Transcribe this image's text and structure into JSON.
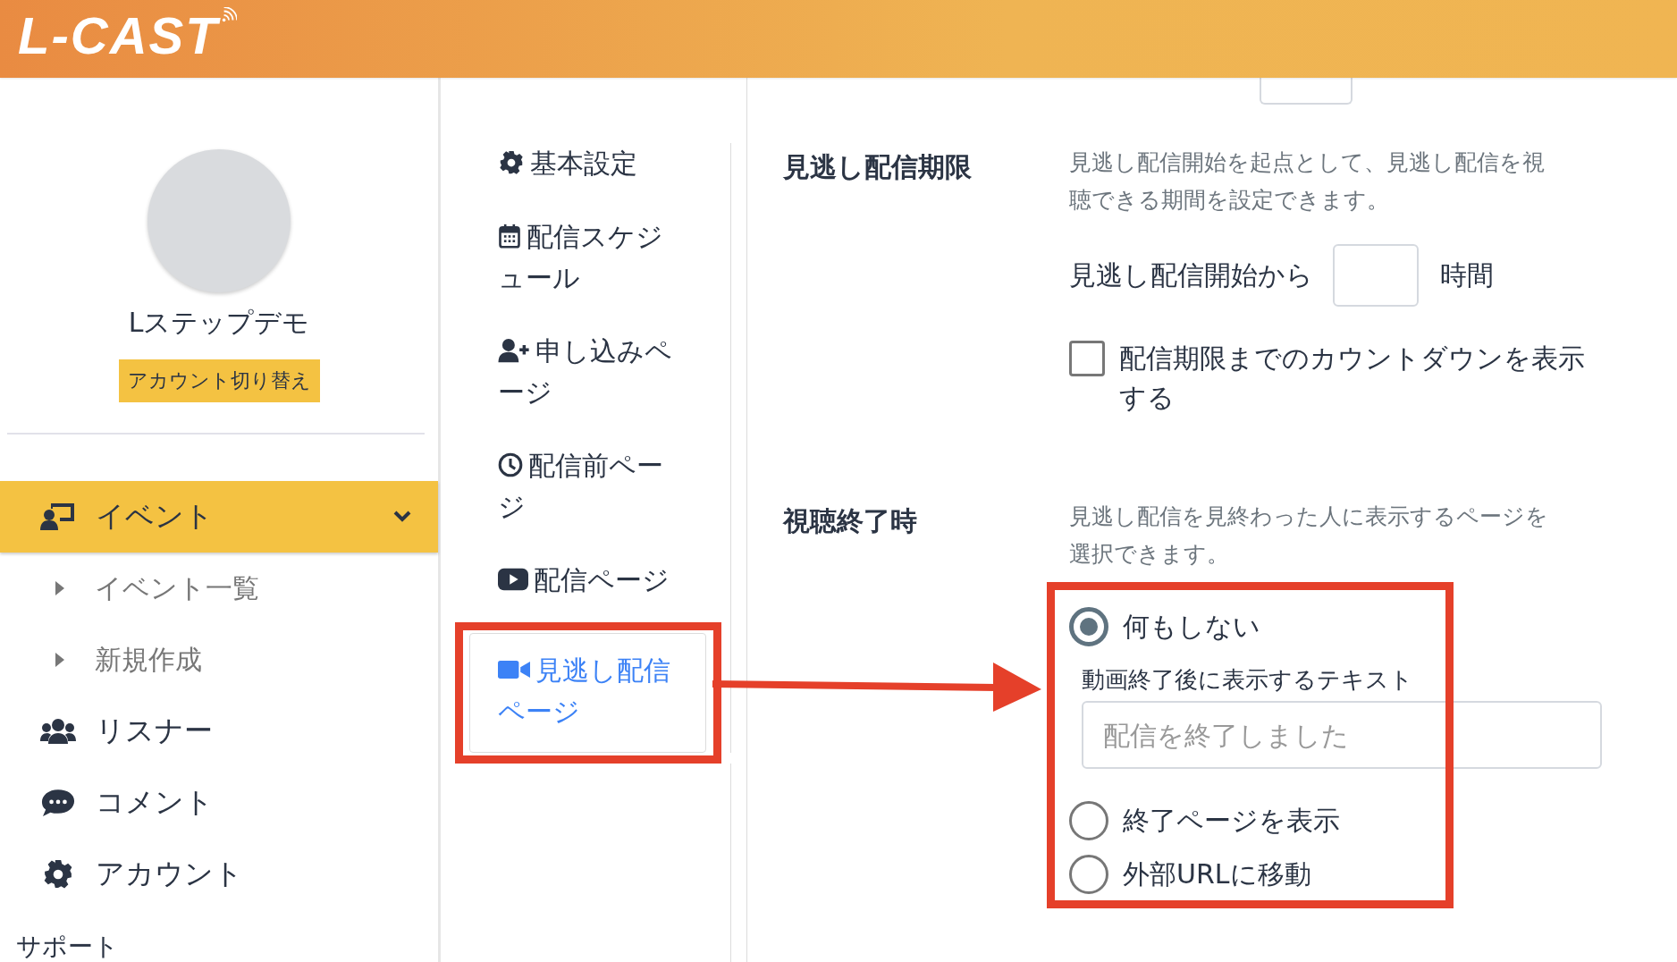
{
  "header": {
    "logo": "L-CAST"
  },
  "sidebar": {
    "user_name": "Lステップデモ",
    "switch_button": "アカウント切り替え",
    "menu": [
      {
        "label": "イベント",
        "selected": true,
        "expanded": true,
        "children": [
          {
            "label": "イベント一覧"
          },
          {
            "label": "新規作成"
          }
        ]
      },
      {
        "label": "リスナー",
        "selected": false
      },
      {
        "label": "コメント",
        "selected": false
      },
      {
        "label": "アカウント",
        "selected": false
      }
    ],
    "support": "サポート"
  },
  "settings_nav": [
    {
      "label": "基本設定",
      "selected": false,
      "highlighted": false
    },
    {
      "label": "配信スケジュール",
      "selected": false,
      "highlighted": false
    },
    {
      "label": "申し込みページ",
      "selected": false,
      "highlighted": false
    },
    {
      "label": "配信前ページ",
      "selected": false,
      "highlighted": false
    },
    {
      "label": "配信ページ",
      "selected": false,
      "highlighted": false
    },
    {
      "label": "見逃し配信ページ",
      "selected": true,
      "highlighted": true
    }
  ],
  "sections": [
    {
      "label": "見逃し配信期限",
      "description": "見逃し配信開始を起点として、見逃し配信を視聴できる期間を設定できます。",
      "duration": {
        "prefix": "見逃し配信開始から",
        "unit": "時間"
      },
      "checkbox": {
        "label": "配信期限までのカウントダウンを表示する",
        "checked": false
      }
    },
    {
      "label": "視聴終了時",
      "description": "見逃し配信を見終わった人に表示するページを選択できます。",
      "highlighted": true,
      "options": [
        {
          "label": "何もしない",
          "selected": true,
          "text_field": {
            "label": "動画終了後に表示するテキスト",
            "placeholder": "配信を終了しました"
          }
        },
        {
          "label": "終了ページを表示",
          "selected": false
        },
        {
          "label": "外部URLに移動",
          "selected": false
        }
      ]
    }
  ]
}
